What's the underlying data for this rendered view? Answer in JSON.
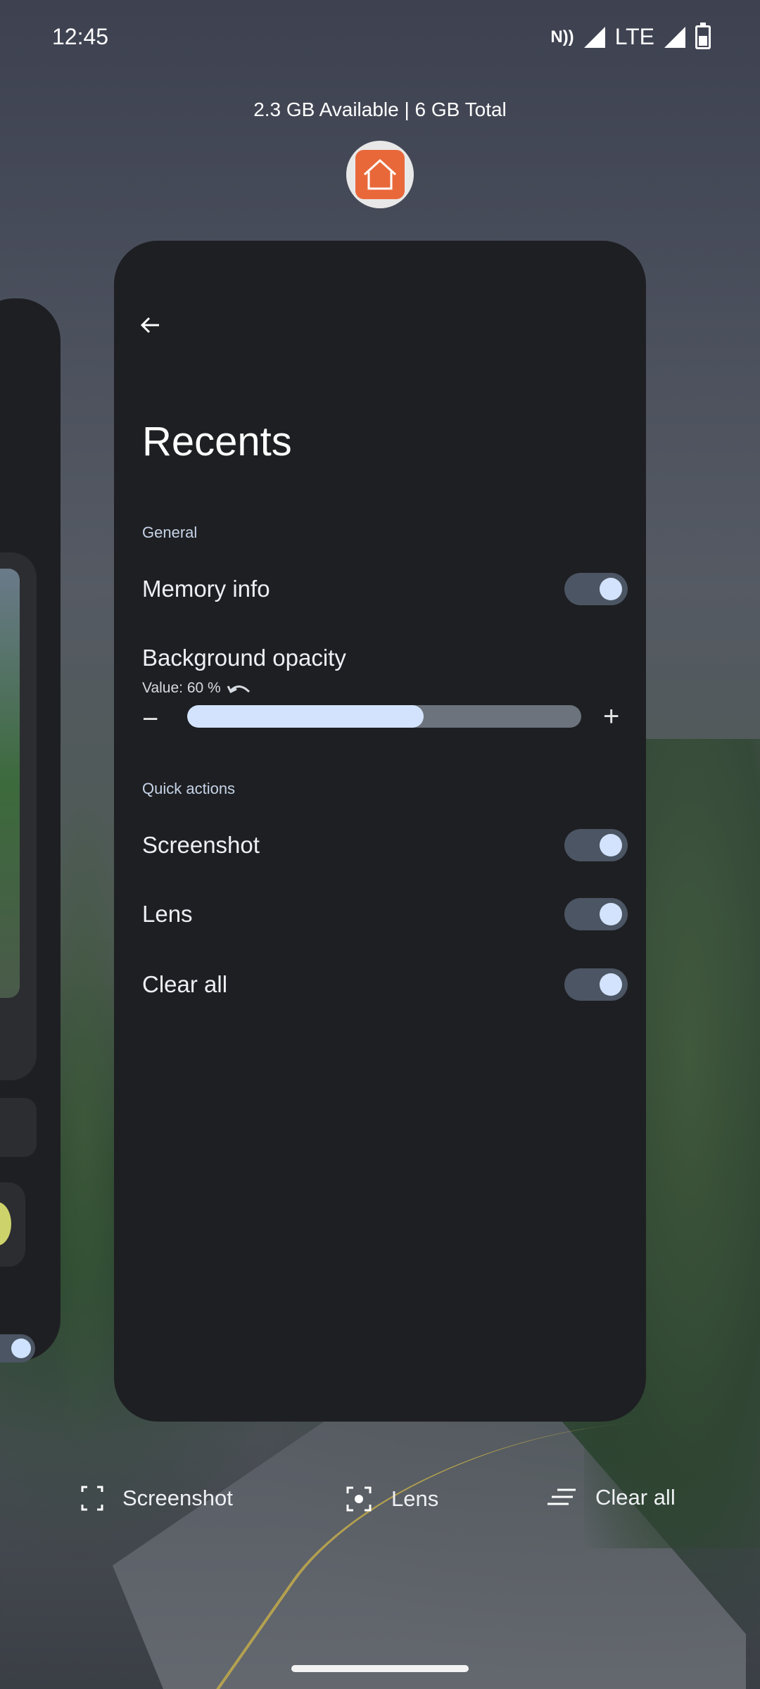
{
  "status_bar": {
    "time": "12:45",
    "network": "LTE",
    "icons": [
      "nfc-icon",
      "signal-icon",
      "signal-icon",
      "battery-icon"
    ]
  },
  "memory_info": "2.3 GB Available | 6 GB Total",
  "app_icon": "home-launcher-icon",
  "settings": {
    "title": "Recents",
    "general_header": "General",
    "memory_info_label": "Memory info",
    "memory_info_on": true,
    "background_opacity_label": "Background opacity",
    "opacity_value_text": "Value: 60 %",
    "opacity_value": 60,
    "quick_actions_header": "Quick actions",
    "screenshot_label": "Screenshot",
    "screenshot_on": true,
    "lens_label": "Lens",
    "lens_on": true,
    "clear_all_label": "Clear all",
    "clear_all_on": true
  },
  "actions": {
    "screenshot": "Screenshot",
    "lens": "Lens",
    "clear_all": "Clear all"
  },
  "colors": {
    "card_bg": "#1e1f22",
    "toggle_track": "#4b5563",
    "toggle_knob": "#d3e3fd",
    "slider_fill": "#d3e3fd",
    "app_icon_bg": "#e9683a"
  }
}
